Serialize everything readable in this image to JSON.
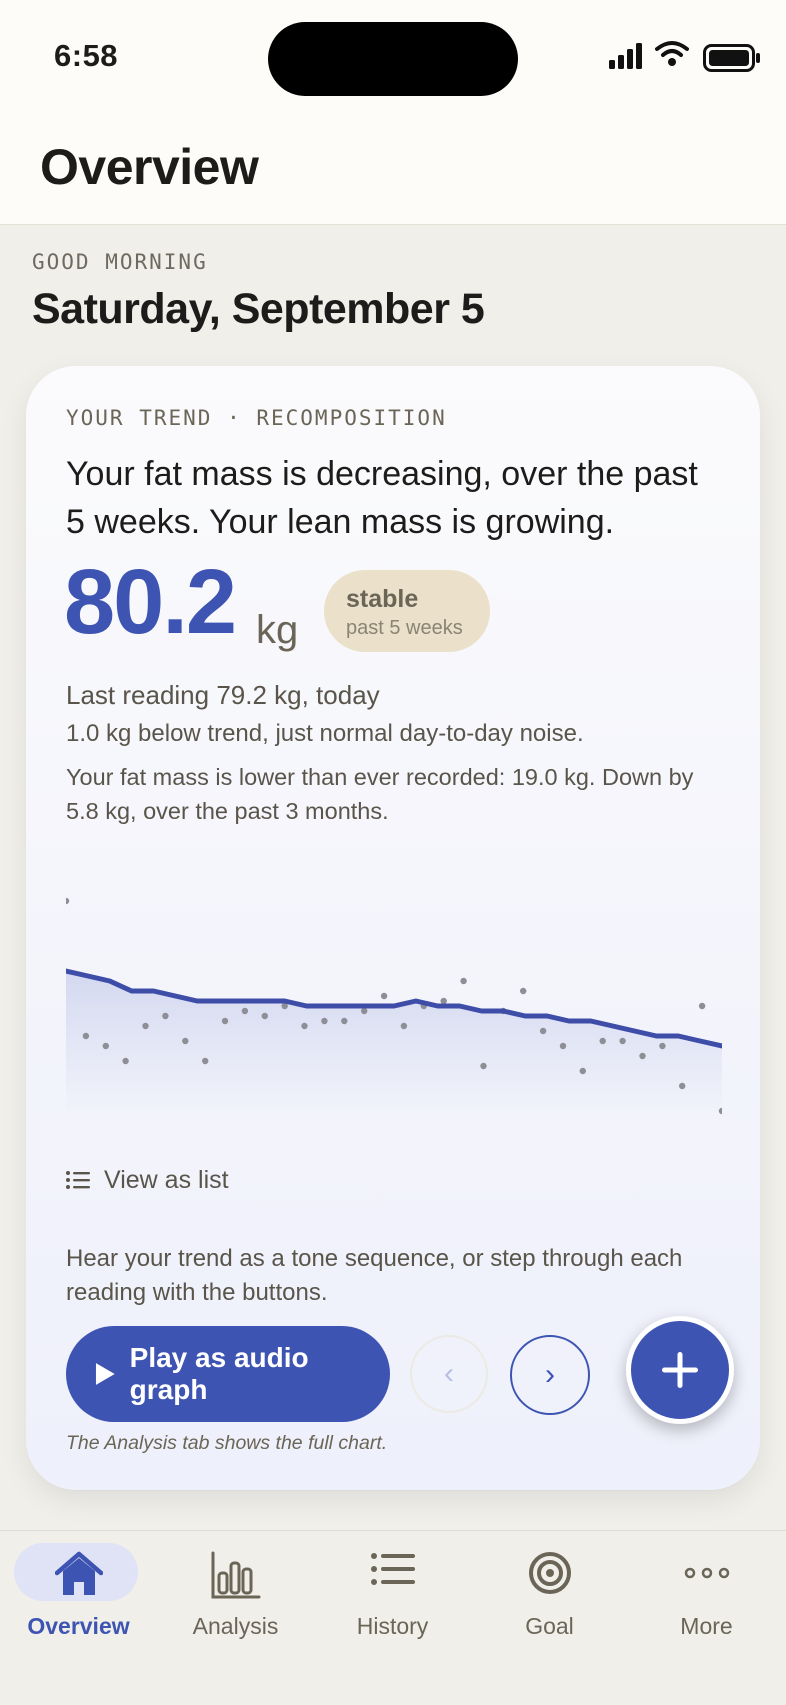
{
  "status_bar": {
    "time": "6:58"
  },
  "header": {
    "title": "Overview"
  },
  "greeting": "GOOD MORNING",
  "date": "Saturday, September 5",
  "trend_card": {
    "eyebrow": "YOUR TREND · RECOMPOSITION",
    "headline": "Your fat mass is decreasing, over the past 5 weeks. Your lean mass is growing.",
    "value": "80.2",
    "unit": "kg",
    "status_pill": {
      "title": "stable",
      "subtitle": "past 5 weeks"
    },
    "last_reading": "Last reading 79.2 kg, today",
    "below_trend": "1.0 kg below trend, just normal day-to-day noise.",
    "fat_note": "Your fat mass is lower than ever recorded: 19.0 kg. Down by 5.8 kg, over the past 3 months.",
    "view_list_label": "View as list",
    "audio_hint": "Hear your trend as a tone sequence, or step through each reading with the buttons.",
    "play_label": "Play as audio graph",
    "prev_label": "‹",
    "next_label": "›",
    "caption": "The Analysis tab shows the full chart."
  },
  "chart_data": {
    "type": "line",
    "trend": [
      80.9,
      80.8,
      80.7,
      80.5,
      80.5,
      80.4,
      80.3,
      80.3,
      80.3,
      80.3,
      80.3,
      80.2,
      80.2,
      80.2,
      80.2,
      80.2,
      80.3,
      80.2,
      80.2,
      80.1,
      80.1,
      80.0,
      80.0,
      79.9,
      79.9,
      79.8,
      79.7,
      79.6,
      79.6,
      79.5,
      79.4
    ],
    "readings": [
      82.3,
      79.6,
      79.4,
      79.1,
      79.8,
      80.0,
      79.5,
      79.1,
      79.9,
      80.1,
      80.0,
      80.2,
      79.8,
      79.9,
      79.9,
      80.1,
      80.4,
      79.8,
      80.2,
      80.3,
      80.7,
      79.0,
      80.1,
      80.5,
      79.7,
      79.4,
      78.9,
      79.5,
      79.5,
      79.2,
      79.4,
      78.6,
      80.2,
      78.1
    ]
  },
  "tabs": [
    {
      "label": "Overview",
      "icon": "house-icon",
      "active": true
    },
    {
      "label": "Analysis",
      "icon": "bar-chart-icon",
      "active": false
    },
    {
      "label": "History",
      "icon": "list-icon",
      "active": false
    },
    {
      "label": "Goal",
      "icon": "target-icon",
      "active": false
    },
    {
      "label": "More",
      "icon": "more-icon",
      "active": false
    }
  ],
  "colors": {
    "accent": "#3e54b3",
    "background": "#f1efea",
    "pill": "#ebe0c9",
    "muted_text": "#6b6557"
  }
}
